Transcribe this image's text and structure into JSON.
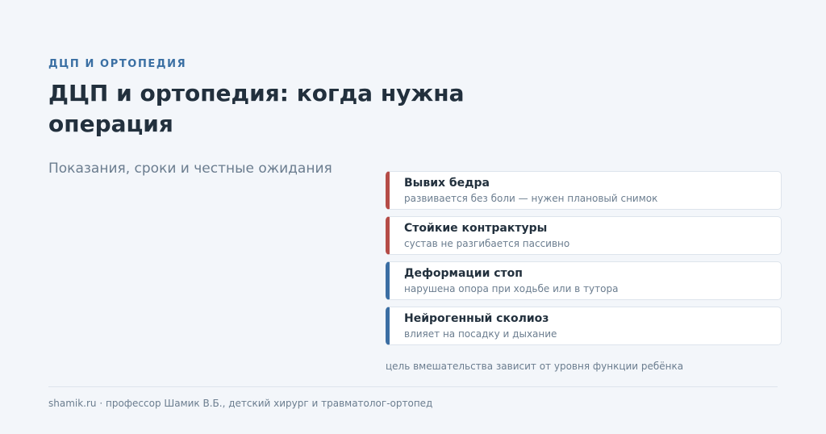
{
  "header": {
    "eyebrow": "ДЦП И ОРТОПЕДИЯ",
    "title": "ДЦП и ортопедия: когда нужна операция",
    "subtitle": "Показания, сроки и честные ожидания"
  },
  "colors": {
    "accent_blue": "#3b6ea3",
    "accent_red": "#b54c47",
    "background": "#f3f6fa",
    "text_dark": "#22303d",
    "text_muted": "#6b7d8f"
  },
  "indications": [
    {
      "title": "Вывих бедра",
      "description": "развивается без боли — нужен плановый снимок",
      "accent": "red"
    },
    {
      "title": "Стойкие контрактуры",
      "description": "сустав не разгибается пассивно",
      "accent": "red"
    },
    {
      "title": "Деформации стоп",
      "description": "нарушена опора при ходьбе или в тутора",
      "accent": "blue"
    },
    {
      "title": "Нейрогенный сколиоз",
      "description": "влияет на посадку и дыхание",
      "accent": "blue"
    }
  ],
  "note": "цель вмешательства зависит от уровня функции ребёнка",
  "footer": {
    "text": "shamik.ru · профессор Шамик В.Б., детский хирург и травматолог-ортопед"
  }
}
